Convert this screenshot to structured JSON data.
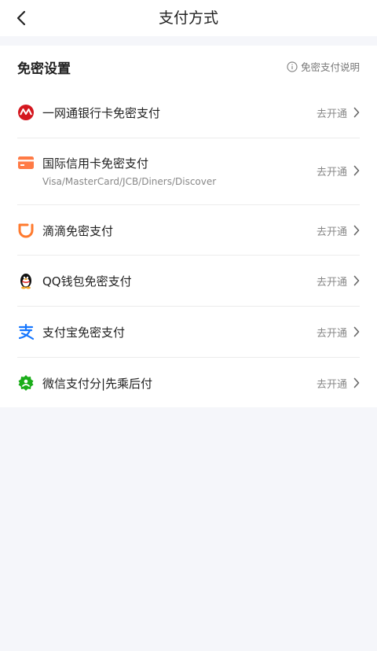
{
  "header": {
    "title": "支付方式"
  },
  "section": {
    "title": "免密设置",
    "help_label": "免密支付说明"
  },
  "items": [
    {
      "label": "一网通银行卡免密支付",
      "action": "去开通",
      "icon": "cmb-bank-icon",
      "color": "#d4171f"
    },
    {
      "label": "国际信用卡免密支付",
      "sublabel": "Visa/MasterCard/JCB/Diners/Discover",
      "action": "去开通",
      "icon": "credit-card-icon",
      "color": "#ff7a45"
    },
    {
      "label": "滴滴免密支付",
      "action": "去开通",
      "icon": "didi-icon",
      "color": "#ff7a2e"
    },
    {
      "label": "QQ钱包免密支付",
      "action": "去开通",
      "icon": "qq-penguin-icon",
      "color": "#111111"
    },
    {
      "label": "支付宝免密支付",
      "action": "去开通",
      "icon": "alipay-icon",
      "color": "#1677ff"
    },
    {
      "label": "微信支付分|先乘后付",
      "action": "去开通",
      "icon": "wechat-pay-score-icon",
      "color": "#1aad19"
    }
  ]
}
